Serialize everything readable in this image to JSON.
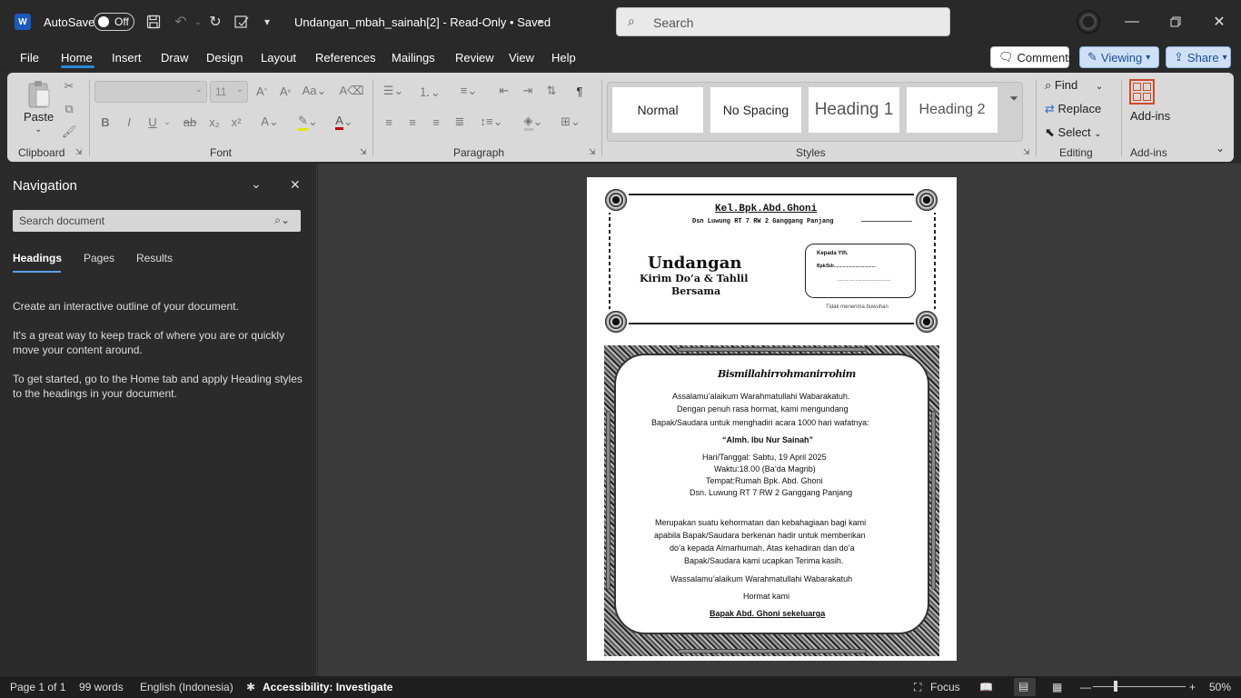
{
  "titlebar": {
    "app_badge": "W",
    "autosave_label": "AutoSave",
    "autosave_state": "Off",
    "doc_title": "Undangan_mbah_sainah[2]  -  Read-Only • Saved",
    "search_placeholder": "Search"
  },
  "tabs": [
    "File",
    "Home",
    "Insert",
    "Draw",
    "Design",
    "Layout",
    "References",
    "Mailings",
    "Review",
    "View",
    "Help"
  ],
  "ribbon_buttons": {
    "comments": "Comments",
    "viewing": "Viewing",
    "share": "Share"
  },
  "ribbon": {
    "clipboard": {
      "paste": "Paste",
      "label": "Clipboard"
    },
    "font": {
      "size": "11",
      "label": "Font"
    },
    "paragraph": {
      "label": "Paragraph"
    },
    "styles": {
      "items": [
        "Normal",
        "No Spacing",
        "Heading 1",
        "Heading 2"
      ],
      "label": "Styles"
    },
    "editing": {
      "find": "Find",
      "replace": "Replace",
      "select": "Select",
      "label": "Editing"
    },
    "addins": {
      "button": "Add-ins",
      "label": "Add-ins"
    }
  },
  "navigation": {
    "title": "Navigation",
    "search_placeholder": "Search document",
    "tabs": [
      "Headings",
      "Pages",
      "Results"
    ],
    "paragraphs": [
      "Create an interactive outline of your document.",
      "It's a great way to keep track of where you are or quickly move your content around.",
      "To get started, go to the Home tab and apply Heading styles to the headings in your document."
    ]
  },
  "document": {
    "header_name": "Kel.Bpk.Abd.Ghoni",
    "header_address": "Dsn Luwung RT 7 RW 2 Ganggang Panjang",
    "title1": "Undangan",
    "title2": "Kirim Do’a & Tahlil",
    "title3": "Bersama",
    "to_label": "Kepada Yth.",
    "to_line": "Bpk/Sdr.................................",
    "to_line2": "..........................................",
    "no_gift": "Tidak menerima buwuhan",
    "bismillah": "Bismillahirrohmanirrohim",
    "greeting": "Assalamu’alaikum Warahmatullahi Wabarakatuh.",
    "line1": "Dengan penuh rasa hormat, kami mengundang",
    "line2": "Bapak/Saudara untuk menghadiri acara 1000 hari wafatnya:",
    "deceased": "“Almh. Ibu Nur Sainah”",
    "day": "Hari/Tanggal: Sabtu, 19 April 2025",
    "time": "Waktu:18.00 (Ba’da Magrib)",
    "place": "Tempat:Rumah Bpk. Abd. Ghoni",
    "address": "Dsn. Luwung RT 7 RW 2 Ganggang Panjang",
    "closing1": "Merupakan suatu kehormatan dan kebahagiaan bagi kami",
    "closing2": "apabila Bapak/Saudara berkenan hadir untuk memberikan",
    "closing3": "do’a kepada Almarhumah. Atas kehadiran dan do’a",
    "closing4": "Bapak/Saudara kami ucapkan Terima kasih.",
    "farewell": "Wassalamu’alaikum Warahmatullahi Wabarakatuh",
    "regards": "Hormat kami",
    "signature": "Bapak Abd. Ghoni sekeluarga"
  },
  "status": {
    "page": "Page 1 of 1",
    "words": "99 words",
    "language": "English (Indonesia)",
    "accessibility": "Accessibility: Investigate",
    "focus": "Focus",
    "zoom": "50%"
  }
}
